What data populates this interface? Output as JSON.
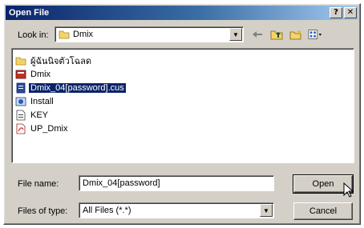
{
  "window": {
    "title": "Open File",
    "help_label": "?",
    "close_label": "✕"
  },
  "lookin": {
    "label": "Look in:",
    "value": "Dmix",
    "icon": "folder-icon"
  },
  "toolbar": {
    "icons": [
      "back-arrow-icon",
      "up-folder-icon",
      "new-folder-icon",
      "view-menu-icon"
    ]
  },
  "files": [
    {
      "name": "ผู้ฉันนิจตัวโฉลด",
      "icon": "folder-icon",
      "selected": false
    },
    {
      "name": "Dmix",
      "icon": "app-icon",
      "selected": false
    },
    {
      "name": "Dmix_04[password].cus",
      "icon": "document-icon",
      "selected": true
    },
    {
      "name": "Install",
      "icon": "installer-icon",
      "selected": false
    },
    {
      "name": "KEY",
      "icon": "text-file-icon",
      "selected": false
    },
    {
      "name": "UP_Dmix",
      "icon": "pdf-icon",
      "selected": false
    }
  ],
  "filename": {
    "label": "File name:",
    "value": "Dmix_04[password]"
  },
  "filetype": {
    "label": "Files of type:",
    "value": "All Files (*.*)"
  },
  "buttons": {
    "open": "Open",
    "cancel": "Cancel"
  },
  "colors": {
    "titlebar": "#0a246a",
    "face": "#d4d0c8",
    "selection": "#0a246a"
  }
}
